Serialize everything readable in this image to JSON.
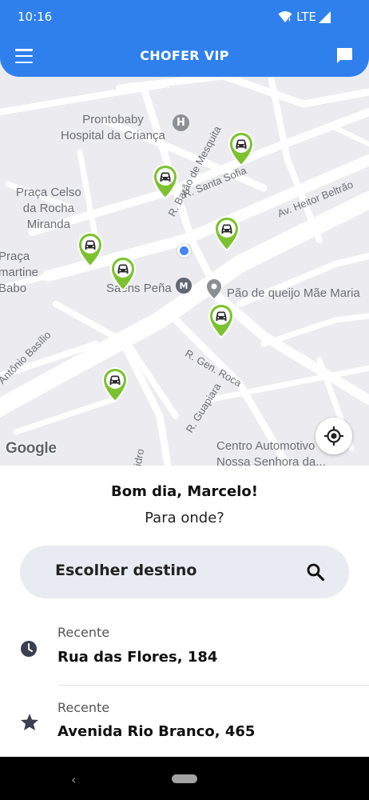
{
  "status_bar": {
    "time": "10:16",
    "network": "LTE"
  },
  "header": {
    "title": "CHOFER VIP",
    "menu_icon": "hamburger-menu-icon",
    "chat_icon": "chat-bubble-icon"
  },
  "map": {
    "pois": {
      "hospital": "Prontobaby\nHospital da Criança",
      "praca_celso": "Praça Celso\nda Rocha\nMiranda",
      "praca_lamartine": "Praça\nLamartine\nBabo",
      "saens_pena": "Saens Peña",
      "pao_de_queijo": "Pão de queijo Mãe Maria",
      "centro_automotivo": "Centro Automotivo\nNossa Senhora da..."
    },
    "streets": {
      "barao": "R. Barão de Mesquita",
      "santa_sofia": "R. Santa Sofia",
      "heitor": "Av. Heitor Beltrão",
      "gen_roca": "R. Gen. Roca",
      "guapiara": "R. Guapiara",
      "antonio_basilio": "Antônio Basílio",
      "idro": "idro"
    },
    "badges": {
      "hospital": "H",
      "metro": "M"
    },
    "attribution": "Google",
    "pin_color": "#7cc230",
    "accent_color": "#2f80ed"
  },
  "greeting": {
    "title": "Bom dia, Marcelo!",
    "subtitle": "Para onde?"
  },
  "search": {
    "placeholder": "Escolher destino",
    "icon": "search-icon"
  },
  "recents": [
    {
      "tag": "Recente",
      "address": "Rua das Flores, 184",
      "icon": "clock-icon"
    },
    {
      "tag": "Recente",
      "address": "Avenida Rio Branco, 465",
      "icon": "star-icon"
    }
  ]
}
